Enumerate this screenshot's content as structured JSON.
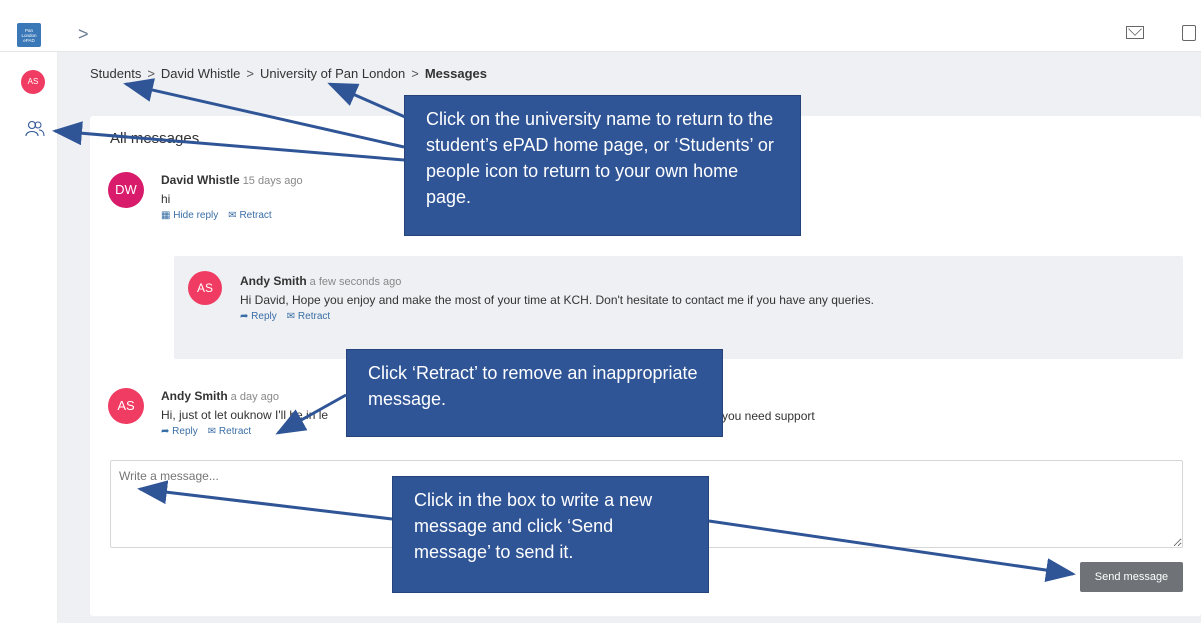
{
  "app": {
    "logo_text": "Pan London ePAD",
    "nav_chevron": ">"
  },
  "sidebar": {
    "avatar_initials": "AS"
  },
  "breadcrumb": {
    "items": [
      "Students",
      "David Whistle",
      "University of Pan London"
    ],
    "current": "Messages",
    "separator": ">"
  },
  "messages": {
    "title": "All messages",
    "thread": [
      {
        "initials": "DW",
        "name": "David Whistle",
        "time": "15 days ago",
        "text": "hi",
        "actions": [
          "Hide reply",
          "Retract"
        ],
        "avatar_color": "#d81b6a"
      },
      {
        "initials": "AS",
        "name": "Andy Smith",
        "time": "a few seconds ago",
        "text": "Hi David, Hope you enjoy and make the most of your time at KCH. Don't hesitate to contact me if you have any queries.",
        "actions": [
          "Reply",
          "Retract"
        ],
        "avatar_color": "#f03c62"
      },
      {
        "initials": "AS",
        "name": "Andy Smith",
        "time": "a day ago",
        "text_start": "Hi, just ot let ouknow I'll be in le",
        "text_end": "you need support",
        "actions": [
          "Reply",
          "Retract"
        ],
        "avatar_color": "#f03c62"
      }
    ],
    "compose_placeholder": "Write a message...",
    "send_label": "Send message"
  },
  "callouts": {
    "navigation": "Click on the university name to return to the student’s ePAD home page, or ‘Students’ or people icon to return to your own home page.",
    "retract": "Click ‘Retract’ to remove an inappropriate message.",
    "compose": "Click in the box to write a new message and click ‘Send message’ to send it."
  },
  "colors": {
    "callout_bg": "#2f5597",
    "accent_avatar": "#f03c62",
    "link": "#3a6ea5",
    "button": "#6f7377"
  }
}
